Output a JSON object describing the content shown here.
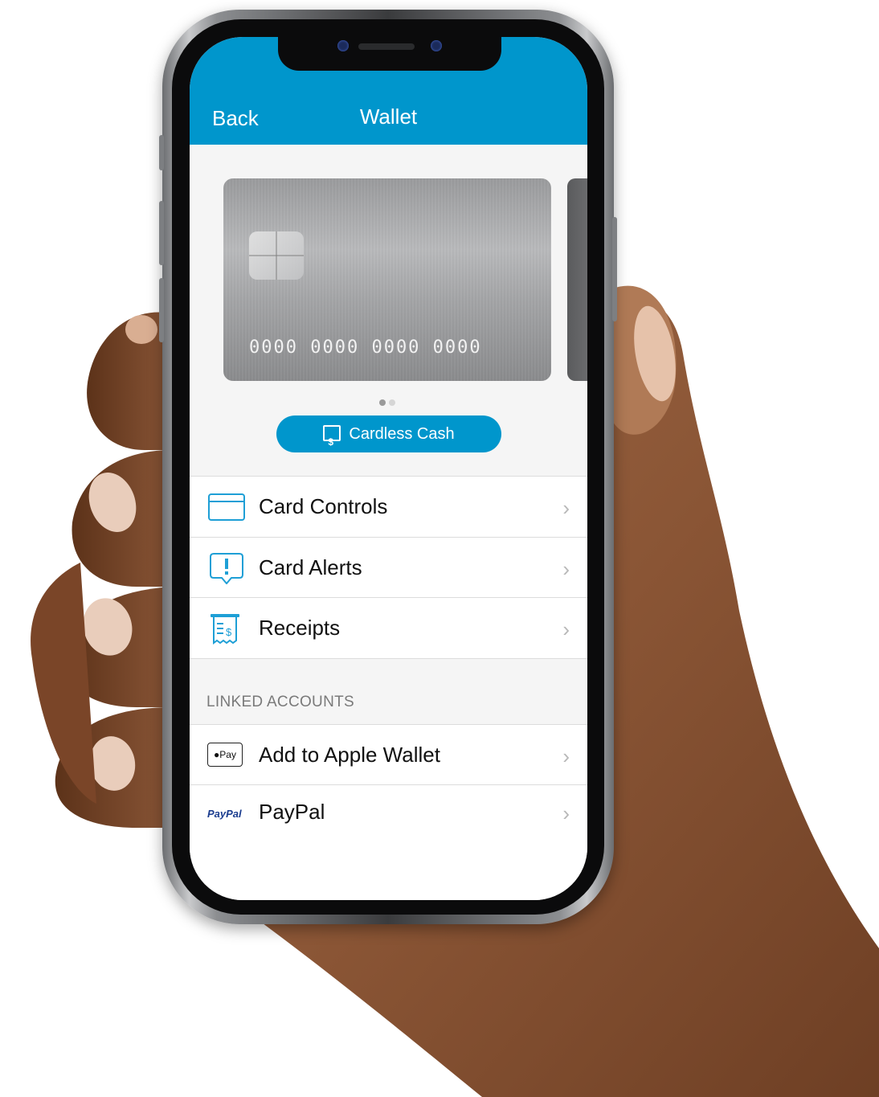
{
  "nav": {
    "back_label": "Back",
    "title": "Wallet"
  },
  "card": {
    "number": "0000 0000 0000 0000",
    "page_index": 1,
    "page_count": 2
  },
  "cardless_cash": {
    "label": "Cardless Cash",
    "icon": "cash-dollar-icon"
  },
  "menu": [
    {
      "label": "Card Controls",
      "icon": "credit-card-icon"
    },
    {
      "label": "Card Alerts",
      "icon": "alert-bubble-icon"
    },
    {
      "label": "Receipts",
      "icon": "receipt-icon"
    }
  ],
  "linked_accounts": {
    "header": "LINKED ACCOUNTS",
    "items": [
      {
        "label": "Add to Apple Wallet",
        "icon": "apple-pay-icon",
        "icon_text": "Pay"
      },
      {
        "label": "PayPal",
        "icon": "paypal-icon",
        "icon_text": "PayPal"
      }
    ]
  },
  "colors": {
    "brand_blue": "#0096cc",
    "icon_blue": "#1e9fd6",
    "chevron": "#b8b8b8",
    "dot_active": "#9a9a9a",
    "dot_inactive": "#d6d6d6"
  }
}
